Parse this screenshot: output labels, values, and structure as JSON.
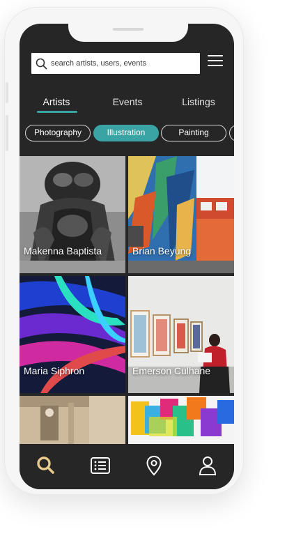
{
  "search": {
    "placeholder": "search artists, users, events"
  },
  "tabs": [
    {
      "label": "Artists",
      "active": true
    },
    {
      "label": "Events",
      "active": false
    },
    {
      "label": "Listings",
      "active": false
    }
  ],
  "chips": [
    {
      "label": "Photography",
      "active": false
    },
    {
      "label": "Illustration",
      "active": true
    },
    {
      "label": "Painting",
      "active": false
    }
  ],
  "artists": [
    {
      "name": "Makenna Baptista"
    },
    {
      "name": "Brian Beyung"
    },
    {
      "name": "Maria Siphron"
    },
    {
      "name": "Emerson Culhane"
    }
  ],
  "nav": [
    "search-icon",
    "list-icon",
    "map-pin-icon",
    "profile-icon"
  ],
  "colors": {
    "accent": "#3aa3a4",
    "screen_bg": "#262626",
    "phone_frame": "#f6f6f6"
  }
}
